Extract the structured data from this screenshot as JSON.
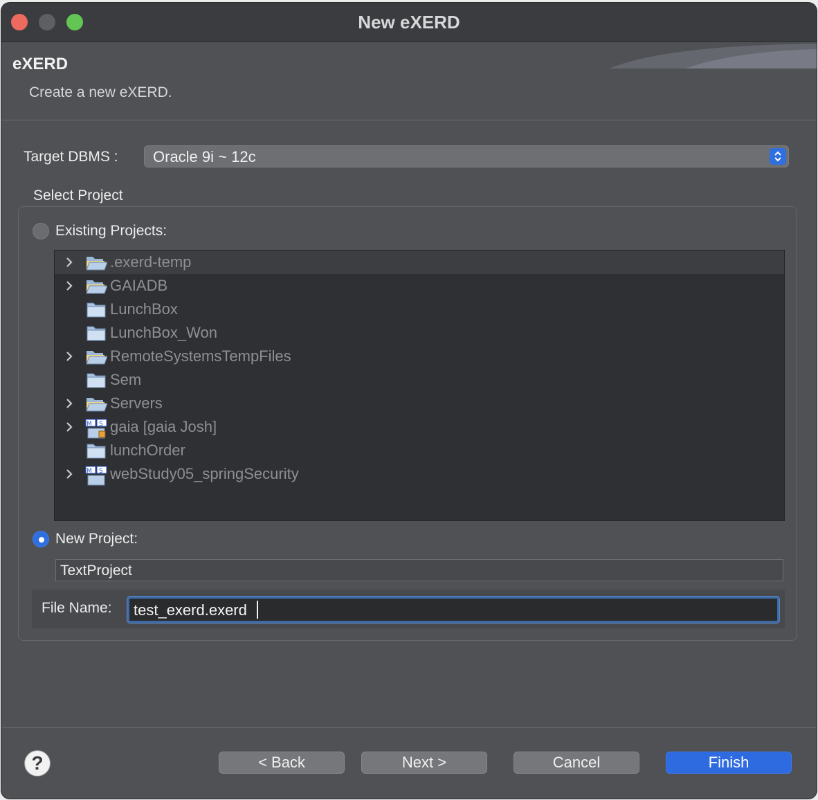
{
  "window": {
    "title": "New eXERD"
  },
  "header": {
    "title": "eXERD",
    "description": "Create a new eXERD."
  },
  "target_dbms": {
    "label": "Target DBMS :",
    "value": "Oracle 9i ~ 12c"
  },
  "select_project": {
    "label": "Select Project",
    "existing_label": "Existing Projects:",
    "new_label": "New Project:",
    "new_project_value": "TextProject",
    "selected": "new"
  },
  "tree": {
    "items": [
      {
        "label": ".exerd-temp",
        "expandable": true,
        "icon": "open-folder-icon",
        "selected": true
      },
      {
        "label": "GAIADB",
        "expandable": true,
        "icon": "open-folder-icon",
        "selected": false
      },
      {
        "label": "LunchBox",
        "expandable": false,
        "icon": "closed-folder-icon",
        "selected": false
      },
      {
        "label": "LunchBox_Won",
        "expandable": false,
        "icon": "closed-folder-icon",
        "selected": false
      },
      {
        "label": "RemoteSystemsTempFiles",
        "expandable": true,
        "icon": "open-folder-icon",
        "selected": false
      },
      {
        "label": "Sem",
        "expandable": false,
        "icon": "closed-folder-icon",
        "selected": false
      },
      {
        "label": "Servers",
        "expandable": true,
        "icon": "open-folder-icon",
        "selected": false
      },
      {
        "label": "gaia [gaia Josh]",
        "expandable": true,
        "icon": "maven-project-locked-icon",
        "selected": false
      },
      {
        "label": "lunchOrder",
        "expandable": false,
        "icon": "closed-folder-icon",
        "selected": false
      },
      {
        "label": "webStudy05_springSecurity",
        "expandable": true,
        "icon": "maven-project-icon",
        "selected": false
      }
    ]
  },
  "file": {
    "label": "File Name:",
    "value": "test_exerd.exerd"
  },
  "buttons": {
    "back": "< Back",
    "next": "Next >",
    "cancel": "Cancel",
    "finish": "Finish",
    "help": "?"
  },
  "colors": {
    "accent": "#2f6be0",
    "window_bg": "#4f5155",
    "tree_bg": "#2f3033"
  }
}
